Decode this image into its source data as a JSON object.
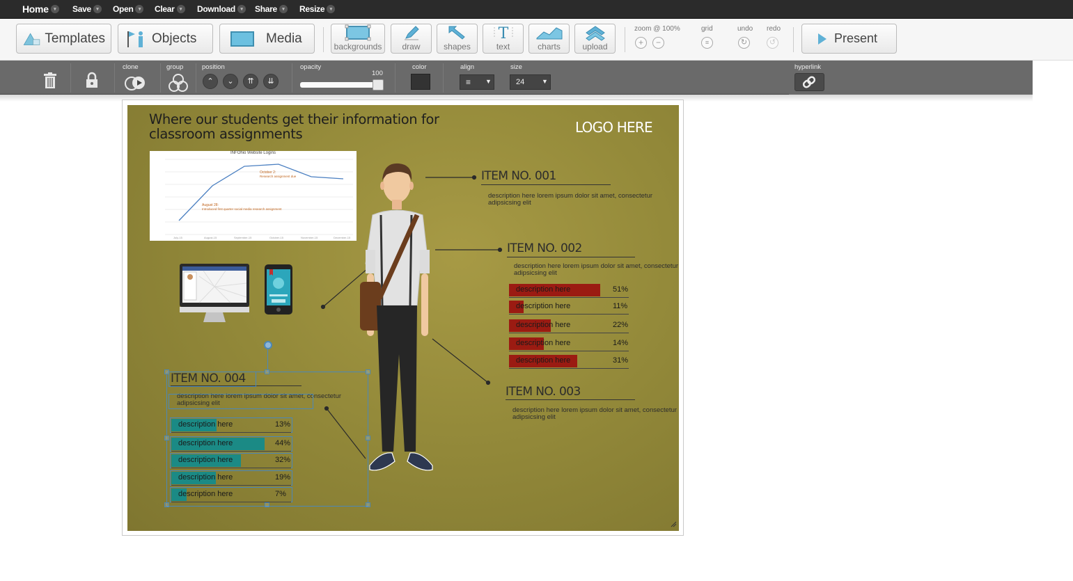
{
  "menu": {
    "home": "Home",
    "save": "Save",
    "open": "Open",
    "clear": "Clear",
    "download": "Download",
    "share": "Share",
    "resize": "Resize"
  },
  "toolbar": {
    "templates": "Templates",
    "objects": "Objects",
    "media": "Media",
    "backgrounds": "backgrounds",
    "draw": "draw",
    "shapes": "shapes",
    "text": "text",
    "charts": "charts",
    "upload": "upload",
    "zoom_label": "zoom @ 100%",
    "grid_label": "grid",
    "undo_label": "undo",
    "redo_label": "redo",
    "present": "Present"
  },
  "props": {
    "clone": "clone",
    "group": "group",
    "position": "position",
    "opacity": "opacity",
    "opacity_value": "100",
    "color": "color",
    "color_value": "#333333",
    "align": "align",
    "size": "size",
    "size_value": "24",
    "hyperlink": "hyperlink"
  },
  "slide": {
    "title": "Where our students get their information for classroom assignments",
    "logo": "LOGO HERE",
    "mini_chart": {
      "title": "INFOhio Website Logins",
      "annotations": [
        "October 2:",
        "Research assignment due",
        "August 28:",
        "Introduced first quarter social media research assignment"
      ]
    },
    "items": [
      {
        "title": "ITEM NO. 001",
        "desc": "description here lorem ipsum dolor sit amet, consectetur adipsicsing elit"
      },
      {
        "title": "ITEM NO. 002",
        "desc": "description here lorem ipsum dolor sit amet, consectetur adipsicsing elit"
      },
      {
        "title": "ITEM NO. 003",
        "desc": "description here lorem ipsum dolor sit amet, consectetur adipsicsing elit"
      },
      {
        "title": "ITEM NO. 004",
        "desc": "description here lorem ipsum dolor sit amet, consectetur adipsicsing elit"
      }
    ],
    "red_bars": [
      {
        "label": "description here",
        "pct": "51%",
        "value": 0.76
      },
      {
        "label": "description here",
        "pct": "11%",
        "value": 0.12
      },
      {
        "label": "description here",
        "pct": "22%",
        "value": 0.35
      },
      {
        "label": "description here",
        "pct": "14%",
        "value": 0.29
      },
      {
        "label": "description here",
        "pct": "31%",
        "value": 0.57
      }
    ],
    "teal_bars": [
      {
        "label": "description here",
        "pct": "13%",
        "value": 0.38
      },
      {
        "label": "description here",
        "pct": "44%",
        "value": 0.78
      },
      {
        "label": "description here",
        "pct": "32%",
        "value": 0.58
      },
      {
        "label": "description here",
        "pct": "19%",
        "value": 0.37
      },
      {
        "label": "description here",
        "pct": "7%",
        "value": 0.13
      }
    ],
    "colors": {
      "red_bar": "#9b1b12",
      "teal_bar": "#1b8a85"
    }
  }
}
